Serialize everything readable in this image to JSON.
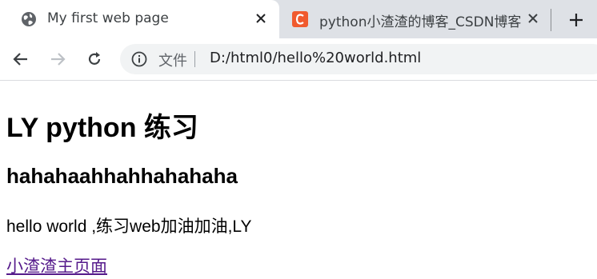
{
  "browser": {
    "tabs": [
      {
        "title": "My first web page",
        "icon": "globe-icon",
        "active": true
      },
      {
        "title": "python小渣渣的博客_CSDN博客",
        "icon": "csdn-logo-icon",
        "active": false
      }
    ],
    "address_bar": {
      "security_label": "文件",
      "url": "D:/html0/hello%20world.html"
    },
    "colors": {
      "csdn": "#f05a2e",
      "link_visited": "#551a8b",
      "tabstrip": "#dee1e6"
    }
  },
  "page": {
    "heading1": "LY python 练习",
    "heading2": "hahahaahhahhahahaha",
    "paragraph": "hello world ,练习web加油加油,LY",
    "link": "小渣渣主页面"
  }
}
